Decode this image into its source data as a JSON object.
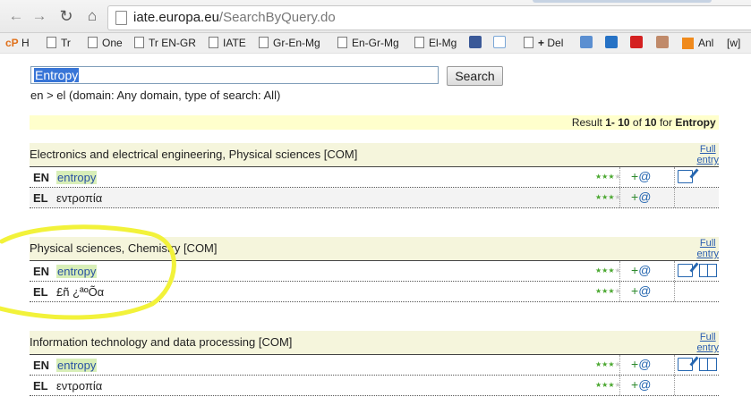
{
  "browser": {
    "url_host": "iate.europa.eu",
    "url_path": "/SearchByQuery.do",
    "bookmarks": [
      {
        "label": "H",
        "prefix": "cP"
      },
      {
        "label": "Tr"
      },
      {
        "label": "One"
      },
      {
        "label": "Tr EN-GR"
      },
      {
        "label": "IATE"
      },
      {
        "label": "Gr-En-Mg"
      },
      {
        "label": "En-Gr-Mg"
      },
      {
        "label": "El-Mg"
      },
      {
        "label": "Del",
        "prefix": "+"
      },
      {
        "label": "Anl"
      },
      {
        "label": "[w]"
      }
    ]
  },
  "search": {
    "value": "Entropy",
    "button_label": "Search",
    "subline": "en > el (domain: Any domain, type of search: All)"
  },
  "results": {
    "prefix": "Result",
    "range": "1- 10",
    "of": "of",
    "total": "10",
    "for": "for",
    "query": "Entropy"
  },
  "full_entry_label": [
    "Full",
    "entry"
  ],
  "entries": [
    {
      "domain": "Electronics and electrical engineering, Physical sciences [COM]",
      "terms": [
        {
          "lang": "EN",
          "term": "entropy",
          "stars": 3
        },
        {
          "lang": "EL",
          "term": "εντροπία",
          "stars": 3
        }
      ]
    },
    {
      "domain": "Physical sciences, Chemistry [COM]",
      "terms": [
        {
          "lang": "EN",
          "term": "entropy",
          "stars": 3
        },
        {
          "lang": "EL",
          "term": "£ñ ¿ªºÕα",
          "stars": 3
        }
      ]
    },
    {
      "domain": "Information technology and data processing [COM]",
      "terms": [
        {
          "lang": "EN",
          "term": "entropy",
          "stars": 3
        },
        {
          "lang": "EL",
          "term": "εντροπία",
          "stars": 3
        }
      ]
    }
  ],
  "icons": {
    "add": "+@",
    "star": "★"
  },
  "colors": {
    "highlight_yellow": "#f5f53a",
    "term_highlight": "#d8eeb8",
    "link_blue": "#2566b0"
  }
}
